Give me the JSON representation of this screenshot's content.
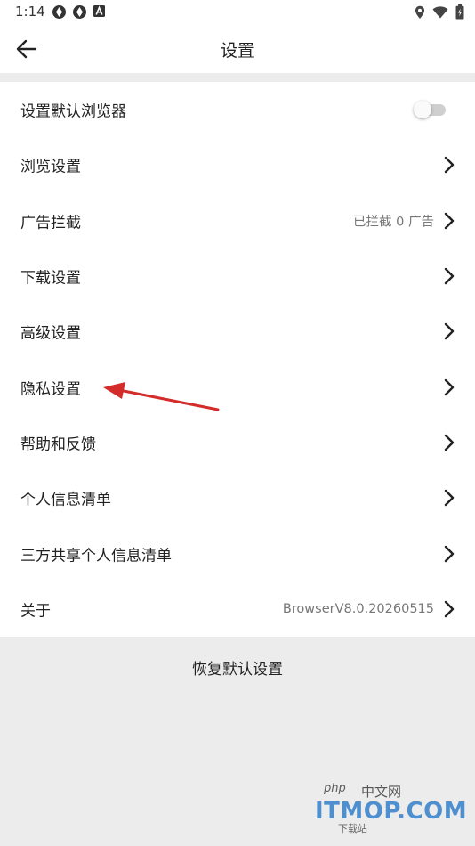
{
  "status_bar": {
    "time": "1:14"
  },
  "header": {
    "title": "设置"
  },
  "settings": {
    "default_browser": "设置默认浏览器",
    "items": [
      {
        "label": "浏览设置",
        "value": ""
      },
      {
        "label": "广告拦截",
        "value": "已拦截 0 广告"
      },
      {
        "label": "下载设置",
        "value": ""
      },
      {
        "label": "高级设置",
        "value": ""
      },
      {
        "label": "隐私设置",
        "value": ""
      },
      {
        "label": "帮助和反馈",
        "value": ""
      },
      {
        "label": "个人信息清单",
        "value": ""
      },
      {
        "label": "三方共享个人信息清单",
        "value": ""
      },
      {
        "label": "关于",
        "value": "BrowserV8.0.20260515"
      }
    ]
  },
  "reset_label": "恢复默认设置",
  "watermark": {
    "php": "php",
    "cn": "中文网",
    "brand": "ITMOP.COM",
    "sub": "下载站"
  },
  "colors": {
    "annotation_arrow": "#d42b2b",
    "watermark_blue": "#4d8fcf"
  }
}
